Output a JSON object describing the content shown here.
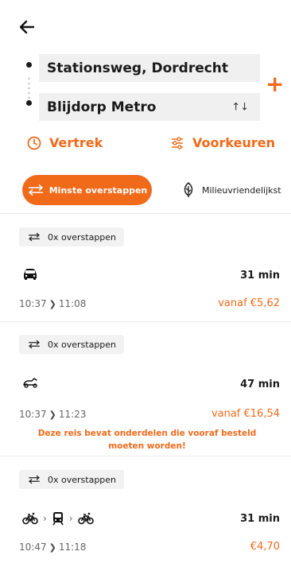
{
  "header": {
    "back_icon": "arrow-left-icon"
  },
  "route": {
    "from": "Stationsweg, Dordrecht",
    "to": "Blijdorp Metro",
    "swap_label": "↑↓",
    "add_label": "+"
  },
  "options": {
    "departure_label": "Vertrek",
    "preferences_label": "Voorkeuren"
  },
  "filters": {
    "active_label": "Minste overstappen",
    "other_label": "Milieuvriendelijkst"
  },
  "results": [
    {
      "transfers": "0x overstappen",
      "mode_icon": "car-icon",
      "duration": "31 min",
      "depart": "10:37",
      "arrive": "11:08",
      "price": "vanaf €5,62",
      "notice": ""
    },
    {
      "transfers": "0x overstappen",
      "mode_icon": "scooter-icon",
      "duration": "47 min",
      "depart": "10:37",
      "arrive": "11:23",
      "price": "vanaf €16,54",
      "notice": "Deze reis bevat onderdelen die vooraf besteld moeten worden!"
    },
    {
      "transfers": "0x overstappen",
      "mode_icon": "bike-train-bike-icon",
      "duration": "31 min",
      "depart": "10:47",
      "arrive": "11:18",
      "price": "€4,70",
      "notice": ""
    }
  ],
  "colors": {
    "accent": "#f06a1a",
    "field_bg": "#f0f0f0",
    "badge_bg": "#f2f2f2"
  }
}
